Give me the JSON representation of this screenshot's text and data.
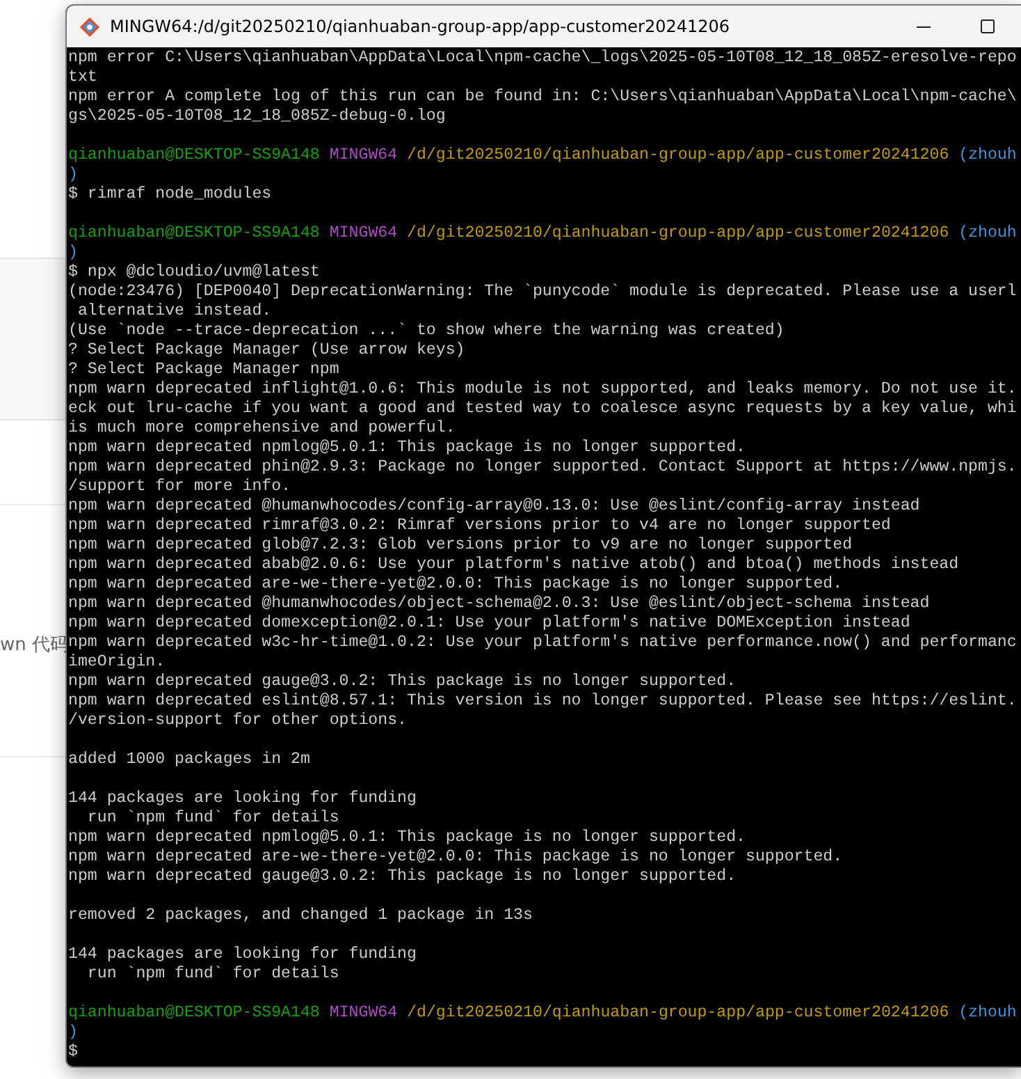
{
  "background_page": {
    "fragment": "wn 代码"
  },
  "window": {
    "title": "MINGW64:/d/git20250210/qianhuaban-group-app/app-customer20241206"
  },
  "terminal": {
    "lines": [
      {
        "kind": "text",
        "text": "npm error C:\\Users\\qianhuaban\\AppData\\Local\\npm-cache\\_logs\\2025-05-10T08_12_18_085Z-eresolve-repo"
      },
      {
        "kind": "text",
        "text": "txt"
      },
      {
        "kind": "text",
        "text": "npm error A complete log of this run can be found in: C:\\Users\\qianhuaban\\AppData\\Local\\npm-cache\\"
      },
      {
        "kind": "text",
        "text": "gs\\2025-05-10T08_12_18_085Z-debug-0.log"
      },
      {
        "kind": "blank"
      },
      {
        "kind": "prompt",
        "user": "qianhuaban@DESKTOP-SS9A148",
        "host": "MINGW64",
        "path": "/d/git20250210/qianhuaban-group-app/app-customer20241206",
        "branch": "(zhouh"
      },
      {
        "kind": "branch_end",
        "text": ")"
      },
      {
        "kind": "text",
        "text": "$ rimraf node_modules"
      },
      {
        "kind": "blank"
      },
      {
        "kind": "prompt",
        "user": "qianhuaban@DESKTOP-SS9A148",
        "host": "MINGW64",
        "path": "/d/git20250210/qianhuaban-group-app/app-customer20241206",
        "branch": "(zhouh"
      },
      {
        "kind": "branch_end",
        "text": ")"
      },
      {
        "kind": "text",
        "text": "$ npx @dcloudio/uvm@latest"
      },
      {
        "kind": "text",
        "text": "(node:23476) [DEP0040] DeprecationWarning: The `punycode` module is deprecated. Please use a userl"
      },
      {
        "kind": "text",
        "text": " alternative instead."
      },
      {
        "kind": "text",
        "text": "(Use `node --trace-deprecation ...` to show where the warning was created)"
      },
      {
        "kind": "text",
        "text": "? Select Package Manager (Use arrow keys)"
      },
      {
        "kind": "text",
        "text": "? Select Package Manager npm"
      },
      {
        "kind": "text",
        "text": "npm warn deprecated inflight@1.0.6: This module is not supported, and leaks memory. Do not use it."
      },
      {
        "kind": "text",
        "text": "eck out lru-cache if you want a good and tested way to coalesce async requests by a key value, whi"
      },
      {
        "kind": "text",
        "text": "is much more comprehensive and powerful."
      },
      {
        "kind": "text",
        "text": "npm warn deprecated npmlog@5.0.1: This package is no longer supported."
      },
      {
        "kind": "text",
        "text": "npm warn deprecated phin@2.9.3: Package no longer supported. Contact Support at https://www.npmjs."
      },
      {
        "kind": "text",
        "text": "/support for more info."
      },
      {
        "kind": "text",
        "text": "npm warn deprecated @humanwhocodes/config-array@0.13.0: Use @eslint/config-array instead"
      },
      {
        "kind": "text",
        "text": "npm warn deprecated rimraf@3.0.2: Rimraf versions prior to v4 are no longer supported"
      },
      {
        "kind": "text",
        "text": "npm warn deprecated glob@7.2.3: Glob versions prior to v9 are no longer supported"
      },
      {
        "kind": "text",
        "text": "npm warn deprecated abab@2.0.6: Use your platform's native atob() and btoa() methods instead"
      },
      {
        "kind": "text",
        "text": "npm warn deprecated are-we-there-yet@2.0.0: This package is no longer supported."
      },
      {
        "kind": "text",
        "text": "npm warn deprecated @humanwhocodes/object-schema@2.0.3: Use @eslint/object-schema instead"
      },
      {
        "kind": "text",
        "text": "npm warn deprecated domexception@2.0.1: Use your platform's native DOMException instead"
      },
      {
        "kind": "text",
        "text": "npm warn deprecated w3c-hr-time@1.0.2: Use your platform's native performance.now() and performanc"
      },
      {
        "kind": "text",
        "text": "imeOrigin."
      },
      {
        "kind": "text",
        "text": "npm warn deprecated gauge@3.0.2: This package is no longer supported."
      },
      {
        "kind": "text",
        "text": "npm warn deprecated eslint@8.57.1: This version is no longer supported. Please see https://eslint."
      },
      {
        "kind": "text",
        "text": "/version-support for other options."
      },
      {
        "kind": "blank"
      },
      {
        "kind": "text",
        "text": "added 1000 packages in 2m"
      },
      {
        "kind": "blank"
      },
      {
        "kind": "text",
        "text": "144 packages are looking for funding"
      },
      {
        "kind": "text",
        "text": "  run `npm fund` for details"
      },
      {
        "kind": "text",
        "text": "npm warn deprecated npmlog@5.0.1: This package is no longer supported."
      },
      {
        "kind": "text",
        "text": "npm warn deprecated are-we-there-yet@2.0.0: This package is no longer supported."
      },
      {
        "kind": "text",
        "text": "npm warn deprecated gauge@3.0.2: This package is no longer supported."
      },
      {
        "kind": "blank"
      },
      {
        "kind": "text",
        "text": "removed 2 packages, and changed 1 package in 13s"
      },
      {
        "kind": "blank"
      },
      {
        "kind": "text",
        "text": "144 packages are looking for funding"
      },
      {
        "kind": "text",
        "text": "  run `npm fund` for details"
      },
      {
        "kind": "blank"
      },
      {
        "kind": "prompt",
        "user": "qianhuaban@DESKTOP-SS9A148",
        "host": "MINGW64",
        "path": "/d/git20250210/qianhuaban-group-app/app-customer20241206",
        "branch": "(zhouh"
      },
      {
        "kind": "branch_end",
        "text": ")"
      },
      {
        "kind": "text",
        "text": "$"
      }
    ]
  }
}
